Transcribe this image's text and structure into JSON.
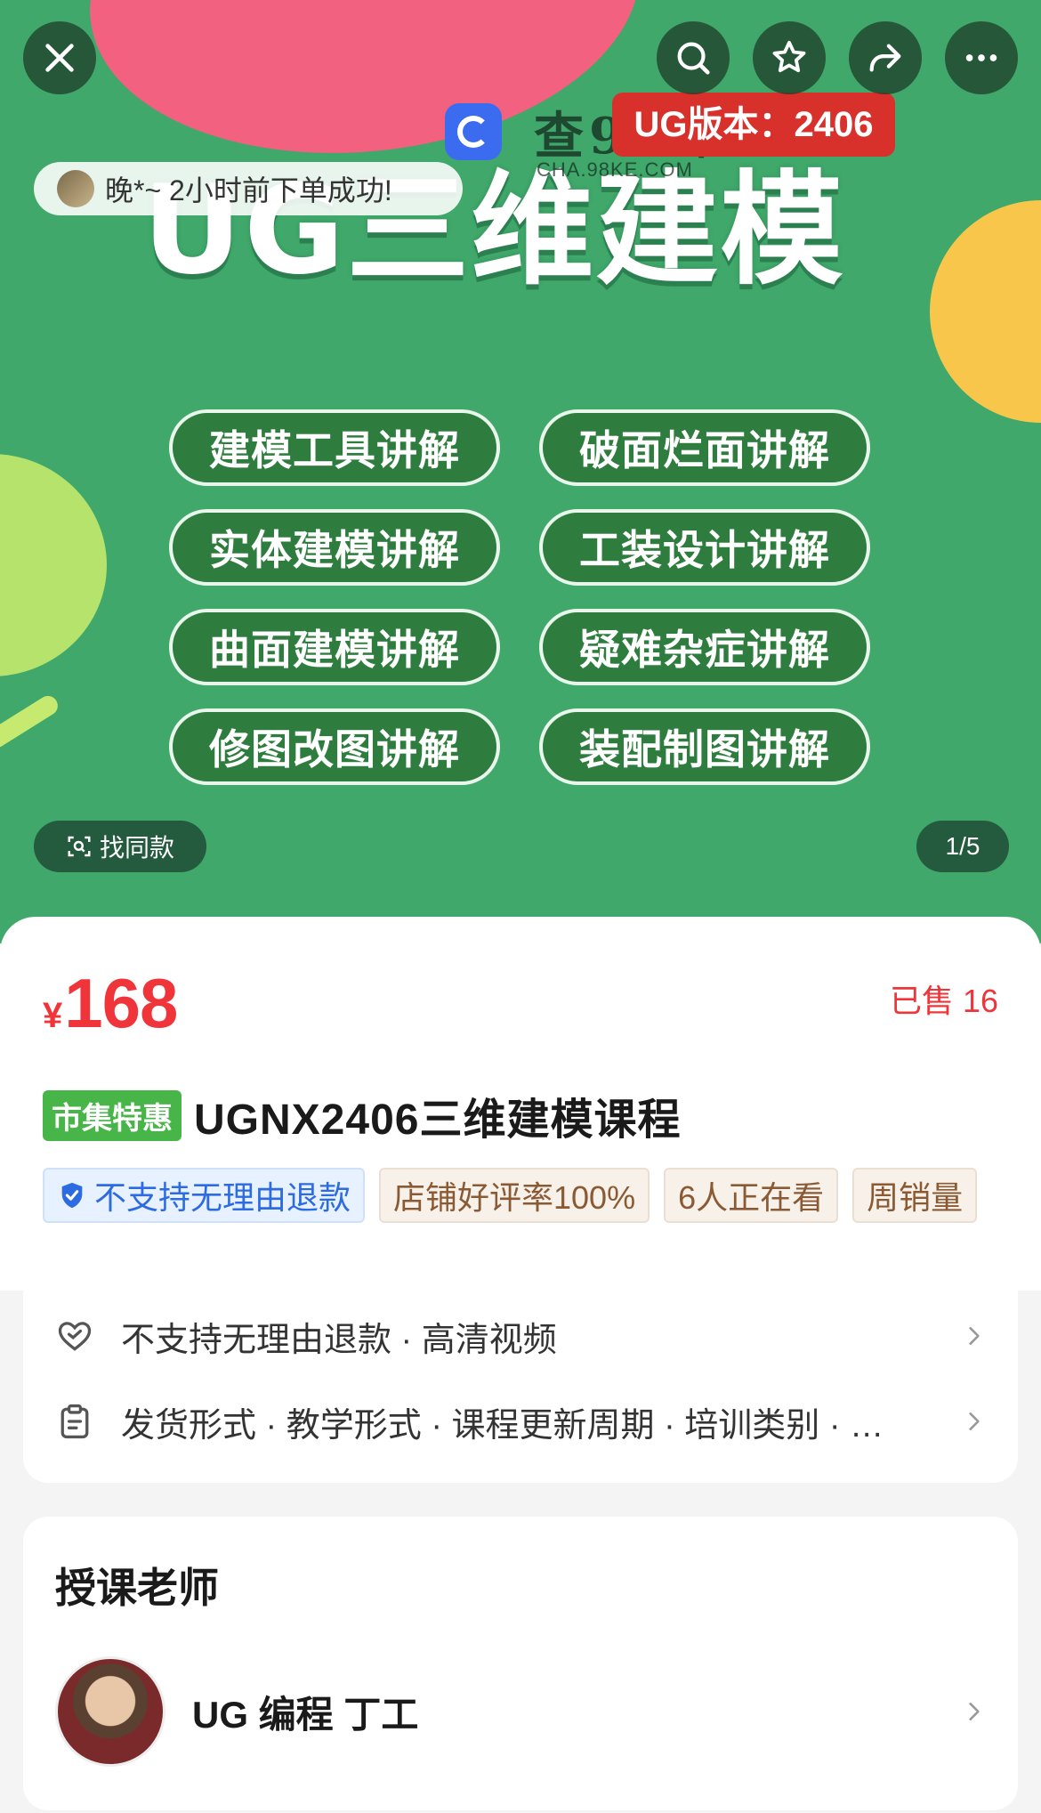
{
  "hero": {
    "title": "UG三维建模",
    "version_badge": "UG版本：2406",
    "watermark_text": "查98课",
    "watermark_sub": "CHA.98KE.COM",
    "order_toast": "晚*~ 2小时前下单成功!",
    "features": [
      "建模工具讲解",
      "破面烂面讲解",
      "实体建模讲解",
      "工装设计讲解",
      "曲面建模讲解",
      "疑难杂症讲解",
      "修图改图讲解",
      "装配制图讲解"
    ],
    "find_same_label": "找同款",
    "page_counter": "1/5",
    "icons": [
      "close-icon",
      "search-icon",
      "star-icon",
      "share-icon",
      "more-icon"
    ],
    "colors": {
      "background": "#3fa86a",
      "pill": "#2e7d3e",
      "badge": "#d8312c"
    }
  },
  "product": {
    "currency": "¥",
    "price": "168",
    "sold": "已售 16",
    "tag": "市集特惠",
    "title": "UGNX2406三维建模课程",
    "chips": [
      "不支持无理由退款",
      "店铺好评率100%",
      "6人正在看",
      "周销量"
    ],
    "accent_color": "#f0353a"
  },
  "service": {
    "rows": [
      {
        "icon": "heart-shield-icon",
        "text": "不支持无理由退款 · 高清视频"
      },
      {
        "icon": "clipboard-icon",
        "text": "发货形式 · 教学形式 · 课程更新周期 · 培训类别 · …"
      }
    ]
  },
  "teacher": {
    "heading": "授课老师",
    "name": "UG 编程  丁工"
  }
}
